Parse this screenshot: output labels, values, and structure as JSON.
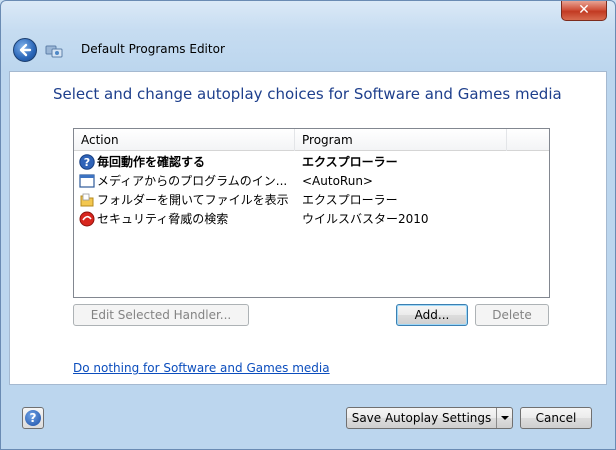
{
  "window": {
    "title": "Default Programs Editor",
    "close_label": "✕"
  },
  "main": {
    "heading": "Select and change autoplay choices for Software and Games media",
    "list": {
      "columns": [
        "Action",
        "Program"
      ],
      "rows": [
        {
          "action": "毎回動作を確認する",
          "program": "エクスプローラー",
          "icon": "question-icon",
          "bold": true
        },
        {
          "action": "メディアからのプログラムのイン...",
          "program": "<AutoRun>",
          "icon": "window-icon",
          "bold": false
        },
        {
          "action": "フォルダーを開いてファイルを表示",
          "program": "エクスプローラー",
          "icon": "folder-icon",
          "bold": false
        },
        {
          "action": "セキュリティ脅威の検索",
          "program": "ウイルスバスター2010",
          "icon": "security-icon",
          "bold": false
        }
      ]
    },
    "buttons": {
      "edit_handler": "Edit Selected Handler...",
      "add": "Add...",
      "delete": "Delete"
    },
    "do_nothing_link": "Do nothing for Software and Games media"
  },
  "footer": {
    "help_label": "?",
    "save_label": "Save Autoplay Settings",
    "cancel_label": "Cancel"
  },
  "colors": {
    "heading": "#1e3f8c",
    "link": "#0b4dbd",
    "frame": "#bcd6ee"
  }
}
